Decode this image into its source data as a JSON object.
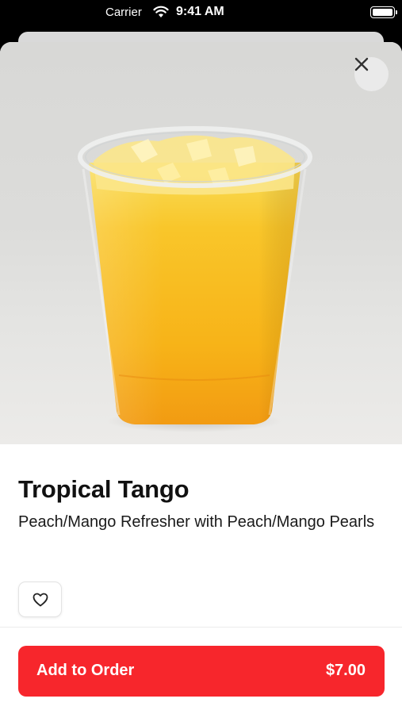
{
  "status_bar": {
    "carrier": "Carrier",
    "time": "9:41 AM"
  },
  "product": {
    "name": "Tropical Tango",
    "description": "Peach/Mango Refresher with Peach/Mango Pearls",
    "price": "$7.00"
  },
  "actions": {
    "add_label": "Add to Order"
  },
  "icons": {
    "close": "close-icon",
    "favorite": "heart-icon"
  },
  "colors": {
    "accent": "#f7262c",
    "drink": "#f7b51a"
  }
}
